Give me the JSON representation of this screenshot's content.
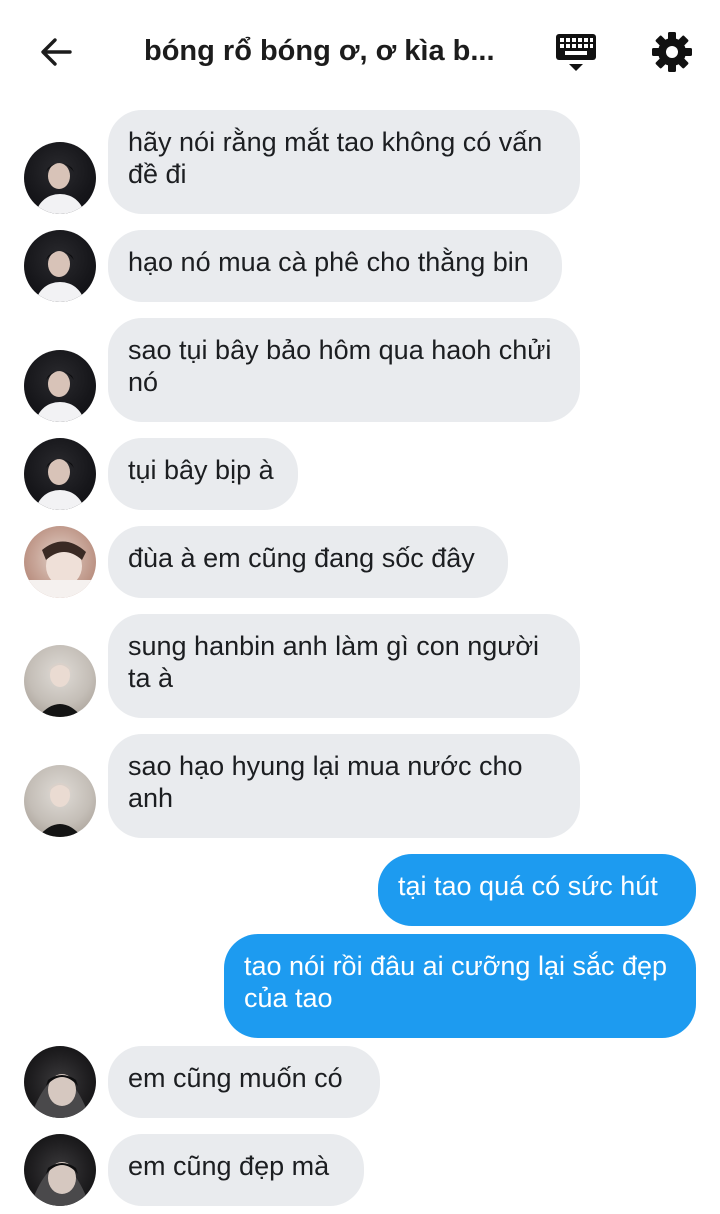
{
  "header": {
    "title": "bóng rổ bóng ơ, ơ kìa b...",
    "back_icon": "arrow-left-icon",
    "keyboard_icon": "keyboard-icon",
    "settings_icon": "gear-icon"
  },
  "colors": {
    "incoming_bubble": "#e9ebee",
    "outgoing_bubble": "#1d9bf0",
    "text_dark": "#1c1e21",
    "text_light": "#ffffff"
  },
  "messages": [
    {
      "sender": "incoming",
      "text": "hãy nói rằng mắt tao không có vấn đề đi"
    },
    {
      "sender": "incoming",
      "text": "hạo nó mua cà phê cho thằng bin"
    },
    {
      "sender": "incoming",
      "text": "sao tụi bây bảo hôm qua haoh chửi nó"
    },
    {
      "sender": "incoming",
      "text": "tụi bây bịp à"
    },
    {
      "sender": "incoming",
      "text": "đùa à em cũng đang sốc đây"
    },
    {
      "sender": "incoming",
      "text": "sung hanbin anh làm gì con người ta à"
    },
    {
      "sender": "incoming",
      "text": "sao hạo hyung lại mua nước cho anh"
    },
    {
      "sender": "outgoing",
      "text": "tại tao quá có sức hút"
    },
    {
      "sender": "outgoing",
      "text": "tao nói rồi đâu ai cưỡng lại sắc đẹp của tao"
    },
    {
      "sender": "incoming",
      "text": "em cũng muốn có"
    },
    {
      "sender": "incoming",
      "text": "em cũng đẹp mà"
    }
  ]
}
